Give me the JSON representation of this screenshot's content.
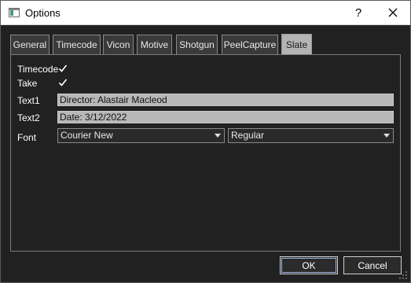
{
  "window": {
    "title": "Options"
  },
  "titlebar": {
    "help_label": "?"
  },
  "tabs": [
    {
      "label": "General"
    },
    {
      "label": "Timecode"
    },
    {
      "label": "Vicon"
    },
    {
      "label": "Motive"
    },
    {
      "label": "Shotgun"
    },
    {
      "label": "PeelCapture"
    },
    {
      "label": "Slate",
      "active": true
    }
  ],
  "slate": {
    "timecode_label": "Timecode",
    "timecode_checked": true,
    "take_label": "Take",
    "take_checked": true,
    "text1_label": "Text1",
    "text1_value": "Director: Alastair Macleod",
    "text2_label": "Text2",
    "text2_value": "Date: 3/12/2022",
    "font_label": "Font",
    "font_family_value": "Courier New",
    "font_style_value": "Regular"
  },
  "buttons": {
    "ok": "OK",
    "cancel": "Cancel"
  },
  "colors": {
    "background": "#212121",
    "active_tab": "#b4b4b4",
    "textfield": "#b8b8b8"
  }
}
